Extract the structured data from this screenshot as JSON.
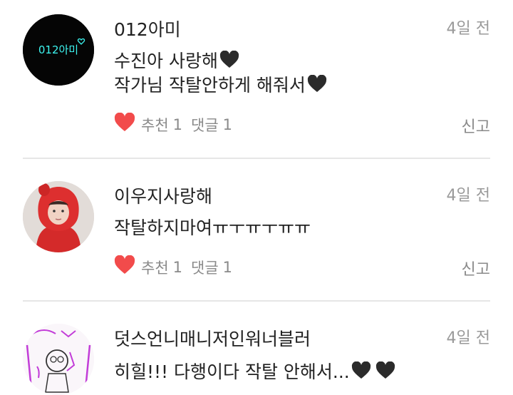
{
  "comments": [
    {
      "username": "012아미",
      "avatar_text": "012아미",
      "time": "4일 전",
      "lines": [
        "수진아 사랑해",
        "작가님 작탈안하게 해줘서"
      ],
      "like_label": "추천",
      "like_count": "1",
      "reply_label": "댓글",
      "reply_count": "1",
      "report_label": "신고"
    },
    {
      "username": "이우지사랑해",
      "time": "4일 전",
      "lines": [
        "작탈하지마여ㅠㅜㅠㅜㅠㅠ"
      ],
      "like_label": "추천",
      "like_count": "1",
      "reply_label": "댓글",
      "reply_count": "1",
      "report_label": "신고"
    },
    {
      "username": "덧스언니매니저인워너블러",
      "time": "4일 전",
      "lines": [
        "히힐!!! 다행이다 작탈 안해서..."
      ]
    }
  ],
  "colors": {
    "like_heart": "#f24b4b",
    "black_heart": "#2b2b2b",
    "neon_text": "#3df5f0",
    "divider": "#e6e6e6"
  }
}
